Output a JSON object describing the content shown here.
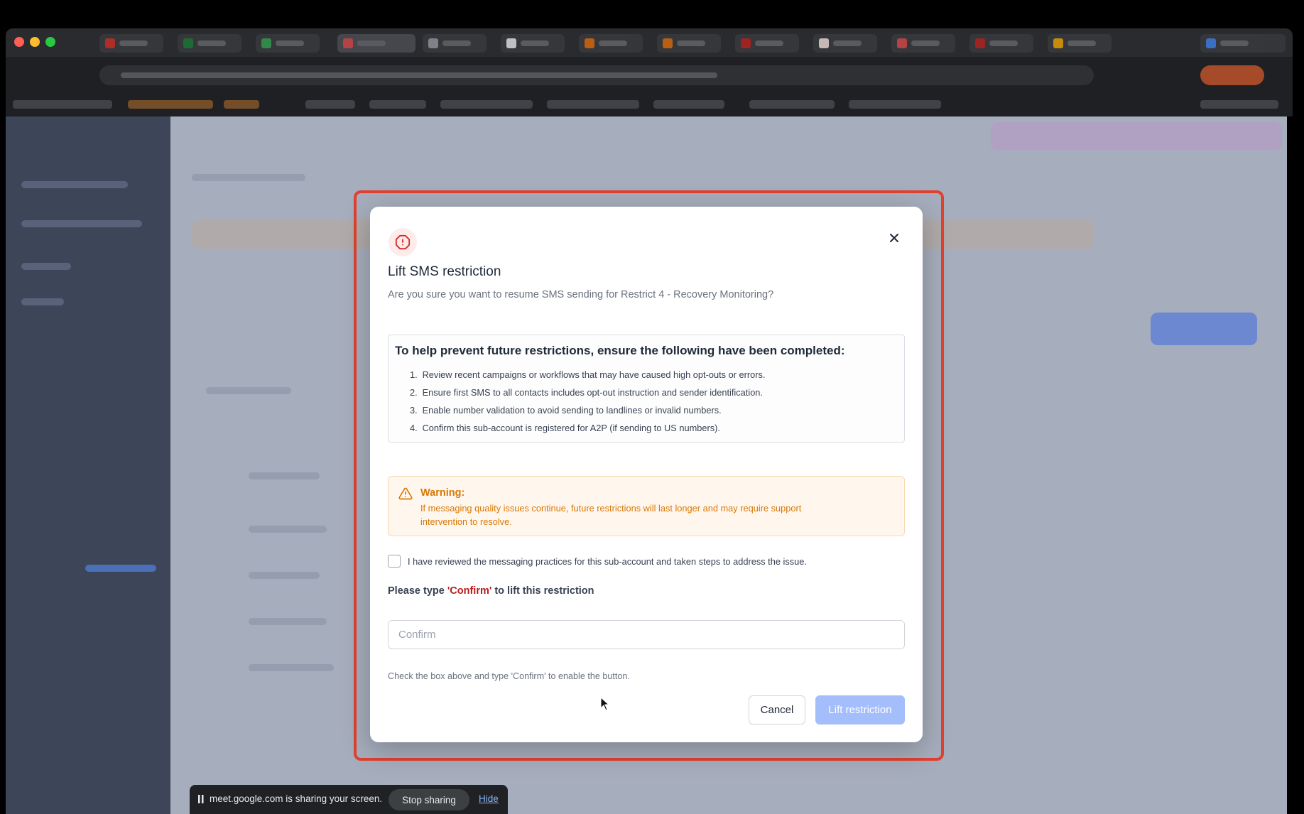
{
  "modal": {
    "title": "Lift SMS restriction",
    "subtitle": "Are you sure you want to resume SMS sending for Restrict 4 - Recovery Monitoring?",
    "steps_heading": "To help prevent future restrictions, ensure the following have been completed:",
    "steps": [
      {
        "num": "1.",
        "text": "Review recent campaigns or workflows that may have caused high opt-outs or errors."
      },
      {
        "num": "2.",
        "text": "Ensure first SMS to all contacts includes opt-out instruction and sender identification."
      },
      {
        "num": "3.",
        "text": "Enable number validation to avoid sending to landlines or invalid numbers."
      },
      {
        "num": "4.",
        "text": "Confirm this sub-account is registered for A2P (if sending to US numbers)."
      }
    ],
    "warning": {
      "title": "Warning:",
      "text": "If messaging quality issues continue, future restrictions will last longer and may require support intervention to resolve."
    },
    "checkbox_label": "I have reviewed the messaging practices for this sub-account and taken steps to address the issue.",
    "type_prompt_before": "Please type ",
    "type_prompt_keyword": "'Confirm'",
    "type_prompt_after": " to lift this restriction",
    "input_placeholder": "Confirm",
    "input_value": "",
    "helper_text": "Check the box above and type 'Confirm' to enable the button.",
    "cancel_label": "Cancel",
    "lift_label": "Lift restriction",
    "icons": {
      "header": "alert-octagon-icon",
      "close": "close-icon",
      "warning": "warning-triangle-icon"
    }
  },
  "screen_share": {
    "message": "meet.google.com is sharing your screen.",
    "stop_label": "Stop sharing",
    "hide_label": "Hide"
  },
  "colors": {
    "highlight_frame": "#e0412f",
    "warning_text": "#d97706",
    "keyword_red": "#b91c1c",
    "primary_disabled": "#a4bdfb"
  }
}
